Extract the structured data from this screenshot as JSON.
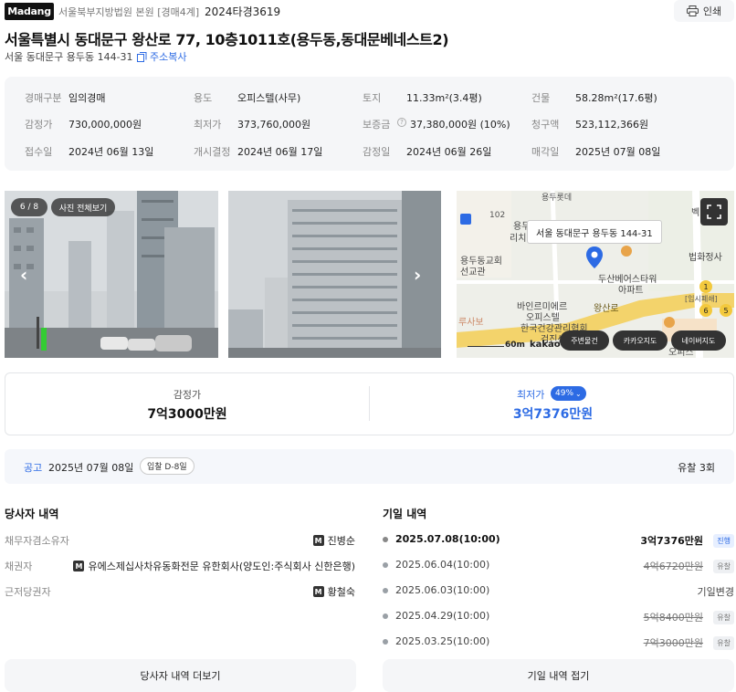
{
  "header": {
    "logo": "Madang",
    "court": "서울북부지방법원 본원 [경매4계]",
    "case_no": "2024타경3619",
    "print_label": "인쇄",
    "title": "서울특별시 동대문구 왕산로 77, 10층1011호(용두동,동대문베네스트2)",
    "address": "서울 동대문구 용두동 144-31",
    "copy_label": "주소복사"
  },
  "info": [
    [
      {
        "k": "경매구분",
        "v": "임의경매"
      },
      {
        "k": "용도",
        "v": "오피스텔(사무)"
      },
      {
        "k": "토지",
        "v": "11.33m²(3.4평)"
      },
      {
        "k": "건물",
        "v": "58.28m²(17.6평)"
      }
    ],
    [
      {
        "k": "감정가",
        "v": "730,000,000원"
      },
      {
        "k": "최저가",
        "v": "373,760,000원"
      },
      {
        "k": "보증금",
        "v": "37,380,000원 (10%)"
      },
      {
        "k": "청구액",
        "v": "523,112,366원"
      }
    ],
    [
      {
        "k": "접수일",
        "v": "2024년 06월 13일"
      },
      {
        "k": "개시결정",
        "v": "2024년 06월 17일"
      },
      {
        "k": "감정일",
        "v": "2024년 06월 26일"
      },
      {
        "k": "매각일",
        "v": "2025년 07월 08일"
      }
    ]
  ],
  "photos": {
    "counter": "6 / 8",
    "view_all": "사진 전체보기"
  },
  "map": {
    "tooltip": "서울 동대문구 용두동 144-31",
    "labels": [
      "용두롯",
      "리치",
      "102",
      "벡",
      "용두동교회",
      "선교관",
      "법화정사",
      "두산베어스타워",
      "아파트",
      "바인르미에르",
      "오피스텔",
      "왕산로",
      "[임시폐쇄]",
      "루사보",
      "한국건강관리협회",
      "검진센터",
      "오피스",
      "1",
      "6",
      "5",
      "60m",
      "kakao"
    ],
    "buttons": [
      "주변물건",
      "카카오지도",
      "네이버지도"
    ]
  },
  "prices": {
    "appraisal_label": "감정가",
    "appraisal_value": "7억3000만원",
    "min_label": "최저가",
    "min_pct": "49%",
    "min_value": "3억7376만원"
  },
  "notice": {
    "label": "공고",
    "date": "2025년 07월 08일",
    "dday": "입찰 D-8일",
    "fail": "유찰 3회"
  },
  "parties": {
    "title": "당사자 내역",
    "rows": [
      {
        "k": "채무자겸소유자",
        "v": "진병순"
      },
      {
        "k": "채권자",
        "v": "유에스제십사차유동화전문 유한회사(양도인:주식회사 신한은행)"
      },
      {
        "k": "근저당권자",
        "v": "황철숙"
      }
    ],
    "more_button": "당사자 내역 더보기"
  },
  "schedule": {
    "title": "기일 내역",
    "rows": [
      {
        "date": "2025.07.08(10:00)",
        "price": "3억7376만원",
        "status": "진행",
        "strike": false,
        "bold": true
      },
      {
        "date": "2025.06.04(10:00)",
        "price": "4억6720만원",
        "status": "유찰",
        "strike": true,
        "bold": false
      },
      {
        "date": "2025.06.03(10:00)",
        "price": "기일변경",
        "status": "",
        "strike": false,
        "bold": false
      },
      {
        "date": "2025.04.29(10:00)",
        "price": "5억8400만원",
        "status": "유찰",
        "strike": true,
        "bold": false
      },
      {
        "date": "2025.03.25(10:00)",
        "price": "7억3000만원",
        "status": "유찰",
        "strike": true,
        "bold": false
      }
    ],
    "fold_button": "기일 내역 접기"
  },
  "colors": {
    "accent": "#2d6be4",
    "info_bg": "#f5f6f8",
    "road_yellow": "#f3d36b"
  }
}
